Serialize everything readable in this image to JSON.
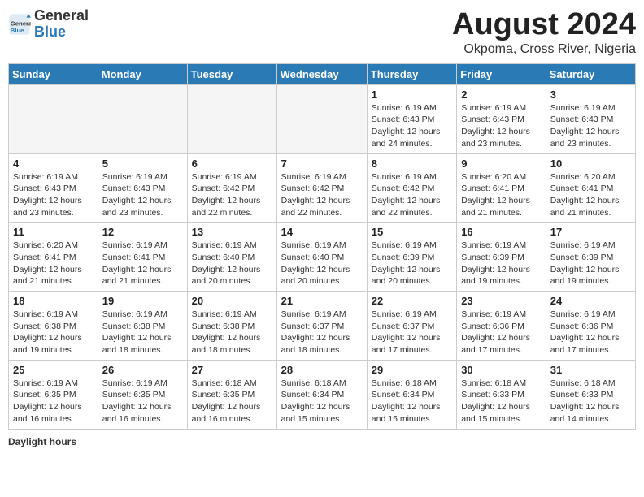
{
  "logo": {
    "general": "General",
    "blue": "Blue"
  },
  "title": "August 2024",
  "subtitle": "Okpoma, Cross River, Nigeria",
  "days_of_week": [
    "Sunday",
    "Monday",
    "Tuesday",
    "Wednesday",
    "Thursday",
    "Friday",
    "Saturday"
  ],
  "weeks": [
    [
      {
        "day": "",
        "info": ""
      },
      {
        "day": "",
        "info": ""
      },
      {
        "day": "",
        "info": ""
      },
      {
        "day": "",
        "info": ""
      },
      {
        "day": "1",
        "sunrise": "6:19 AM",
        "sunset": "6:43 PM",
        "daylight": "12 hours and 24 minutes."
      },
      {
        "day": "2",
        "sunrise": "6:19 AM",
        "sunset": "6:43 PM",
        "daylight": "12 hours and 23 minutes."
      },
      {
        "day": "3",
        "sunrise": "6:19 AM",
        "sunset": "6:43 PM",
        "daylight": "12 hours and 23 minutes."
      }
    ],
    [
      {
        "day": "4",
        "sunrise": "6:19 AM",
        "sunset": "6:43 PM",
        "daylight": "12 hours and 23 minutes."
      },
      {
        "day": "5",
        "sunrise": "6:19 AM",
        "sunset": "6:43 PM",
        "daylight": "12 hours and 23 minutes."
      },
      {
        "day": "6",
        "sunrise": "6:19 AM",
        "sunset": "6:42 PM",
        "daylight": "12 hours and 22 minutes."
      },
      {
        "day": "7",
        "sunrise": "6:19 AM",
        "sunset": "6:42 PM",
        "daylight": "12 hours and 22 minutes."
      },
      {
        "day": "8",
        "sunrise": "6:19 AM",
        "sunset": "6:42 PM",
        "daylight": "12 hours and 22 minutes."
      },
      {
        "day": "9",
        "sunrise": "6:20 AM",
        "sunset": "6:41 PM",
        "daylight": "12 hours and 21 minutes."
      },
      {
        "day": "10",
        "sunrise": "6:20 AM",
        "sunset": "6:41 PM",
        "daylight": "12 hours and 21 minutes."
      }
    ],
    [
      {
        "day": "11",
        "sunrise": "6:20 AM",
        "sunset": "6:41 PM",
        "daylight": "12 hours and 21 minutes."
      },
      {
        "day": "12",
        "sunrise": "6:19 AM",
        "sunset": "6:41 PM",
        "daylight": "12 hours and 21 minutes."
      },
      {
        "day": "13",
        "sunrise": "6:19 AM",
        "sunset": "6:40 PM",
        "daylight": "12 hours and 20 minutes."
      },
      {
        "day": "14",
        "sunrise": "6:19 AM",
        "sunset": "6:40 PM",
        "daylight": "12 hours and 20 minutes."
      },
      {
        "day": "15",
        "sunrise": "6:19 AM",
        "sunset": "6:39 PM",
        "daylight": "12 hours and 20 minutes."
      },
      {
        "day": "16",
        "sunrise": "6:19 AM",
        "sunset": "6:39 PM",
        "daylight": "12 hours and 19 minutes."
      },
      {
        "day": "17",
        "sunrise": "6:19 AM",
        "sunset": "6:39 PM",
        "daylight": "12 hours and 19 minutes."
      }
    ],
    [
      {
        "day": "18",
        "sunrise": "6:19 AM",
        "sunset": "6:38 PM",
        "daylight": "12 hours and 19 minutes."
      },
      {
        "day": "19",
        "sunrise": "6:19 AM",
        "sunset": "6:38 PM",
        "daylight": "12 hours and 18 minutes."
      },
      {
        "day": "20",
        "sunrise": "6:19 AM",
        "sunset": "6:38 PM",
        "daylight": "12 hours and 18 minutes."
      },
      {
        "day": "21",
        "sunrise": "6:19 AM",
        "sunset": "6:37 PM",
        "daylight": "12 hours and 18 minutes."
      },
      {
        "day": "22",
        "sunrise": "6:19 AM",
        "sunset": "6:37 PM",
        "daylight": "12 hours and 17 minutes."
      },
      {
        "day": "23",
        "sunrise": "6:19 AM",
        "sunset": "6:36 PM",
        "daylight": "12 hours and 17 minutes."
      },
      {
        "day": "24",
        "sunrise": "6:19 AM",
        "sunset": "6:36 PM",
        "daylight": "12 hours and 17 minutes."
      }
    ],
    [
      {
        "day": "25",
        "sunrise": "6:19 AM",
        "sunset": "6:35 PM",
        "daylight": "12 hours and 16 minutes."
      },
      {
        "day": "26",
        "sunrise": "6:19 AM",
        "sunset": "6:35 PM",
        "daylight": "12 hours and 16 minutes."
      },
      {
        "day": "27",
        "sunrise": "6:18 AM",
        "sunset": "6:35 PM",
        "daylight": "12 hours and 16 minutes."
      },
      {
        "day": "28",
        "sunrise": "6:18 AM",
        "sunset": "6:34 PM",
        "daylight": "12 hours and 15 minutes."
      },
      {
        "day": "29",
        "sunrise": "6:18 AM",
        "sunset": "6:34 PM",
        "daylight": "12 hours and 15 minutes."
      },
      {
        "day": "30",
        "sunrise": "6:18 AM",
        "sunset": "6:33 PM",
        "daylight": "12 hours and 15 minutes."
      },
      {
        "day": "31",
        "sunrise": "6:18 AM",
        "sunset": "6:33 PM",
        "daylight": "12 hours and 14 minutes."
      }
    ]
  ],
  "footer": {
    "label": "Daylight hours"
  }
}
